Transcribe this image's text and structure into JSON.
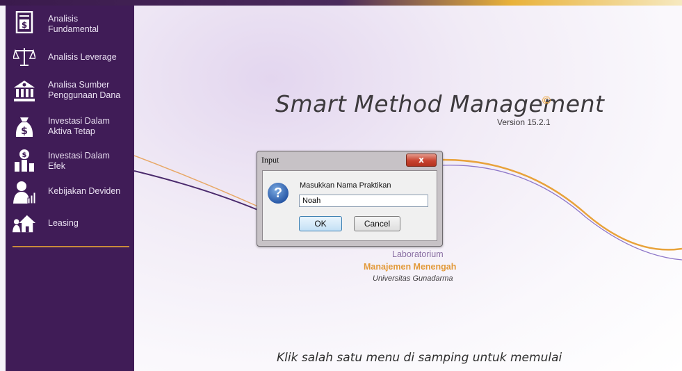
{
  "sidebar": {
    "items": [
      {
        "label": "Analisis\nFundamental",
        "icon": "document-dollar-icon"
      },
      {
        "label": "Analisis Leverage",
        "icon": "balance-scale-icon"
      },
      {
        "label": "Analisa Sumber\nPenggunaan Dana",
        "icon": "bank-icon"
      },
      {
        "label": "Investasi Dalam\nAktiva Tetap",
        "icon": "money-bag-icon"
      },
      {
        "label": "Investasi Dalam\nEfek",
        "icon": "money-chart-icon"
      },
      {
        "label": "Kebijakan Deviden",
        "icon": "person-chart-icon"
      },
      {
        "label": "Leasing",
        "icon": "house-people-icon"
      }
    ]
  },
  "main": {
    "title": "Smart Method Management",
    "copyright": "©",
    "version": "Version 15.2.1",
    "lab_line1": "Laboratorium",
    "lab_line2": "Manajemen Menengah",
    "lab_line3": "Universitas Gunadarma",
    "hint": "Klik salah satu menu di samping untuk memulai"
  },
  "dialog": {
    "title": "Input",
    "close": "x",
    "prompt": "Masukkan Nama Praktikan",
    "input_value": "Noah",
    "ok_label": "OK",
    "cancel_label": "Cancel",
    "icon": "question-icon"
  },
  "colors": {
    "sidebar_bg": "#401c57",
    "accent_orange": "#e29a3a",
    "accent_purple": "#8a6fa3"
  }
}
